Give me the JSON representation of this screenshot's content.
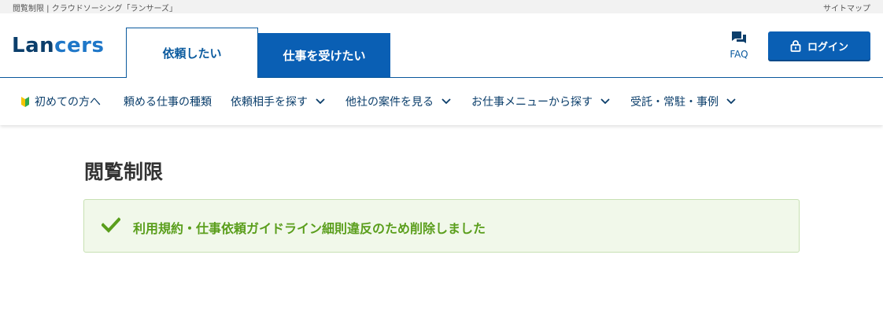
{
  "topbar": {
    "breadcrumb": "閲覧制限 | クラウドソーシング「ランサーズ」",
    "sitemap": "サイトマップ"
  },
  "header": {
    "logo_main": "Lan",
    "logo_accent": "cers",
    "tab_client": "依頼したい",
    "tab_worker": "仕事を受けたい",
    "faq_label": "FAQ",
    "login_label": "ログイン"
  },
  "nav": {
    "items": [
      {
        "label": "初めての方へ",
        "icon": "beginner-leaf-icon",
        "dropdown": false
      },
      {
        "label": "頼める仕事の種類",
        "dropdown": false
      },
      {
        "label": "依頼相手を探す",
        "dropdown": true
      },
      {
        "label": "他社の案件を見る",
        "dropdown": true
      },
      {
        "label": "お仕事メニューから探す",
        "dropdown": true
      },
      {
        "label": "受託・常駐・事例",
        "dropdown": true
      }
    ]
  },
  "main": {
    "title": "閲覧制限",
    "alert_message": "利用規約・仕事依頼ガイドライン細則違反のため削除しました"
  },
  "colors": {
    "brand_navy": "#0b3e6b",
    "brand_blue": "#0a5fb4",
    "success_green": "#5a9e1c",
    "success_bg": "#f1f8ea"
  }
}
